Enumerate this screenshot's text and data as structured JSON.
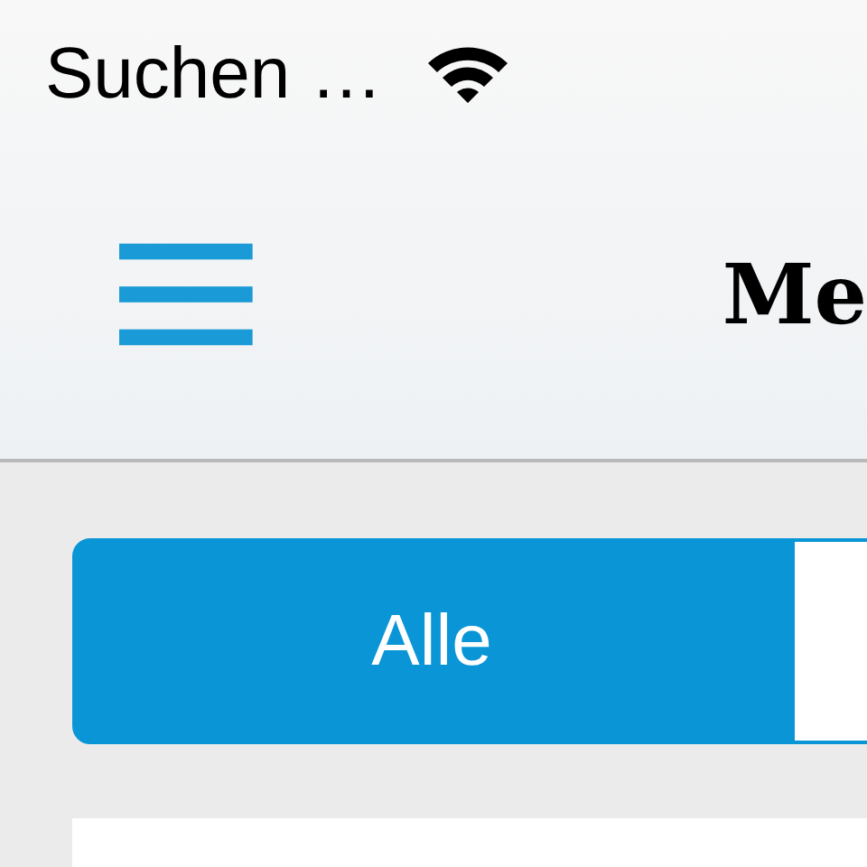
{
  "status_bar": {
    "carrier": "Suchen …"
  },
  "nav_bar": {
    "title": "Me"
  },
  "tabs": [
    {
      "label": "Alle",
      "selected": true
    },
    {
      "selected": false
    }
  ]
}
